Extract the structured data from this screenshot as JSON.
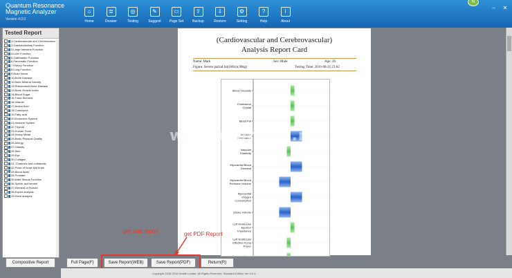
{
  "app": {
    "title_line1": "Quantum Resonance",
    "title_line2": "Magnetic Analyzer",
    "version": "Version 4.0.0",
    "badge": "N"
  },
  "toolbar": [
    {
      "name": "home",
      "label": "Home",
      "glyph": "⌂"
    },
    {
      "name": "dossier",
      "label": "Dossier",
      "glyph": "≣"
    },
    {
      "name": "testing",
      "label": "Testing",
      "glyph": "◎"
    },
    {
      "name": "suggest",
      "label": "Suggest",
      "glyph": "✎"
    },
    {
      "name": "page-set",
      "label": "Page Set",
      "glyph": "▭"
    },
    {
      "name": "backup",
      "label": "Backup",
      "glyph": "⇪"
    },
    {
      "name": "restore",
      "label": "Restore",
      "glyph": "⇩"
    },
    {
      "name": "setting",
      "label": "Setting",
      "glyph": "⚙"
    },
    {
      "name": "help",
      "label": "Help",
      "glyph": "?"
    },
    {
      "name": "about",
      "label": "About",
      "glyph": "i"
    }
  ],
  "window_controls": {
    "minimize": "–",
    "close": "✕"
  },
  "left_panel": {
    "title": "Tested Report",
    "items": [
      "1.Cardiovascular and Cerebrovascular",
      "2.Gastrointestinal Function",
      "3.Large Intestine Function",
      "4.Liver Function",
      "5.Gallbladder Function",
      "6.Pancreatic Function",
      "7.Kidney Function",
      "8.Lung Function",
      "9.Brain Nerve",
      "10.Bone Disease",
      "11.Bone Mineral Density",
      "12.Rheumatoid Bone Disease",
      "13.Bone Growth Index",
      "14.Blood Sugar",
      "15.Trace Element",
      "16.Vitamin",
      "17.Amino Acid",
      "18.Coenzyme",
      "19.Fatty acid",
      "20.Endocrine System",
      "21.Immune System",
      "22.Thyroid",
      "23.Human Toxin",
      "24.Heavy Metal",
      "25.Basic Physical Quality",
      "26.Allergy",
      "27.Obesity",
      "28.Skin",
      "29.Eye",
      "30.Collagen",
      "31. Channels and collaterals",
      "32.Pulse of heart and brain",
      "33.Blood lipids",
      "34.Prostate",
      "35.Male Sexual Function",
      "36.Sperm and semen",
      "37.Element of Human",
      "38.Expert analysis",
      "39.Hand analysis"
    ],
    "compositive_button": "Compositive Report"
  },
  "report": {
    "title_line1": "(Cardiovascular and Cerebrovascular)",
    "title_line2": "Analysis Report Card",
    "name": "Name: Mark",
    "sex": "Sex: Male",
    "age": "Age: 26",
    "figure": "Figure: Severe partial fat(180cm,90kg)",
    "testing_time": "Testing Time: 2016-08-21 23:02"
  },
  "chart_data": {
    "type": "bar",
    "orientation": "horizontal",
    "categories": [
      "Blood Viscosity",
      "Cholesterol Crystal",
      "Blood Fat",
      "Vascular Resistance",
      "Vascular Elasticity",
      "Myocardial Blood Demand",
      "Myocardial Blood Perfusion Volume",
      "Myocardial Oxygen Consumption",
      "Stroke Volume",
      "Left Ventricular Ejection Impedance",
      "Left Ventricular Effective Pump Power",
      "Coronary Artery Elasticity"
    ],
    "values": [
      0.5,
      0.5,
      0.5,
      1.5,
      -0.5,
      1.5,
      -1.5,
      1.5,
      -1.5,
      0.5,
      -0.5,
      -0.5
    ],
    "status": [
      "normal",
      "normal",
      "normal",
      "abnormal",
      "normal",
      "abnormal",
      "abnormal",
      "abnormal",
      "abnormal",
      "normal",
      "normal",
      "normal"
    ],
    "colors": {
      "normal": "#5cc45c",
      "abnormal": "#2c63c9"
    },
    "xlim": [
      -2,
      2
    ]
  },
  "watermark": "www.monkon.net",
  "annotations": {
    "web": "get web report",
    "pdf": "get PDF Report"
  },
  "buttons": {
    "full_page": "Full Page(F)",
    "save_web": "Save Report(WEB)",
    "save_pdf": "Save Report(PDF)",
    "return": "Return(R)"
  },
  "footer": {
    "copyright": "Copyright 2008-2016 Health Leader. All Rights Reserved. Standard Edition Ver 4.0.0"
  }
}
